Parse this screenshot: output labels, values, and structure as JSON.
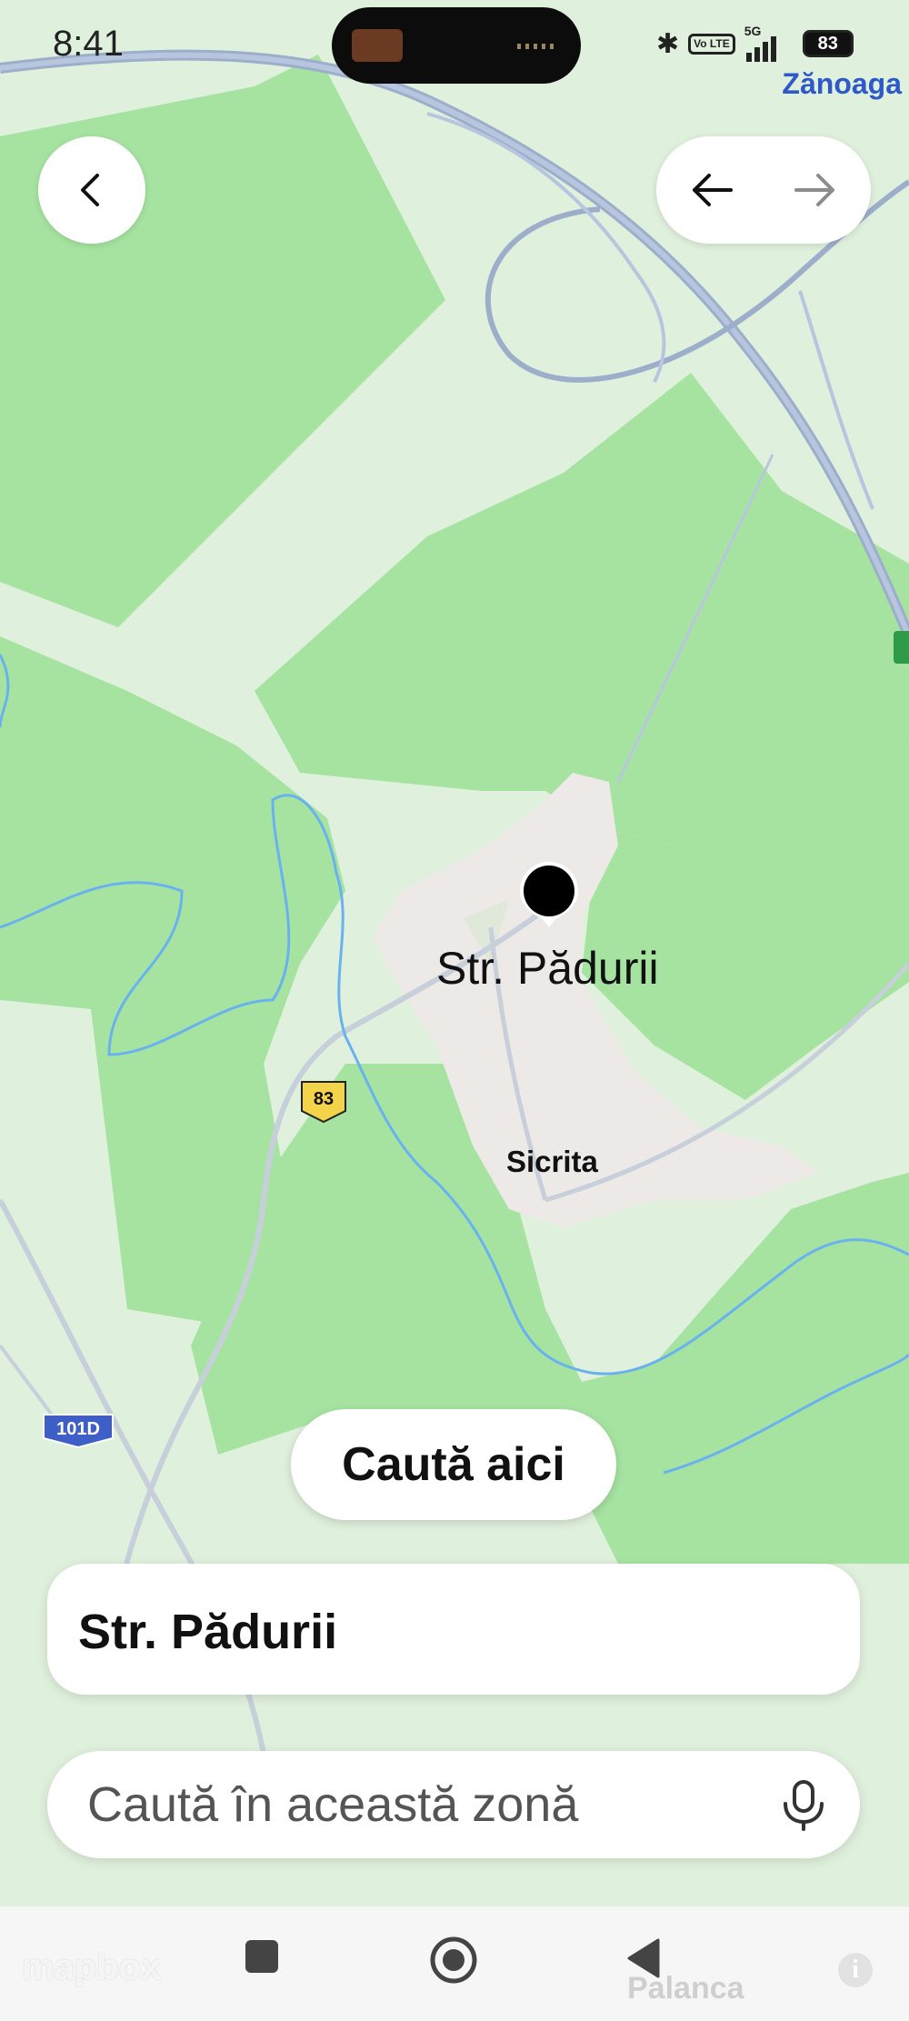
{
  "status_bar": {
    "time": "8:41",
    "network": "5G",
    "volte_label": "Vo LTE",
    "battery": "83"
  },
  "map": {
    "top_right_place": "Zănoaga",
    "pin_label": "Str. Pădurii",
    "place_label": "Sicrita",
    "road_shields": [
      {
        "label": "83",
        "color": "#f2d34a"
      },
      {
        "label": "101D",
        "color": "#3d5fc7"
      }
    ],
    "bottom_place": "Palanca",
    "attribution_logo": "mapbox",
    "colors": {
      "forest": "#a6e3a1",
      "open_land": "#dff0dc",
      "built_area": "#ece9e6",
      "highway": "#9daecb",
      "river": "#69b2ef"
    }
  },
  "toolbar": {
    "back_icon": "chevron-left-icon",
    "undo_icon": "arrow-left-icon",
    "redo_icon": "arrow-right-icon"
  },
  "search_here_label": "Caută aici",
  "result": {
    "title": "Str. Pădurii"
  },
  "search": {
    "placeholder": "Caută în această zonă",
    "mic_icon": "microphone-icon"
  },
  "system_nav": {
    "recents_icon": "square-icon",
    "home_icon": "circle-icon",
    "back_icon": "triangle-back-icon"
  }
}
